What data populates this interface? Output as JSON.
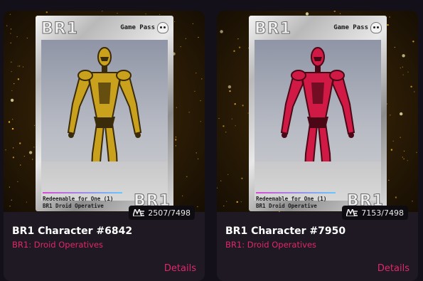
{
  "cards": [
    {
      "card_logo": "BR1",
      "pass_label": "Game Pass",
      "redeem_line1": "Redeemable for One (1)",
      "redeem_line2": "BR1 Droid Operative",
      "bottom_logo": "BR1",
      "count": "2507/7498",
      "title": "BR1 Character #6842",
      "collection": "BR1: Droid Operatives",
      "details_label": "Details",
      "robot_color": "#c9a11c",
      "robot_dark": "#3a2b0a"
    },
    {
      "card_logo": "BR1",
      "pass_label": "Game Pass",
      "redeem_line1": "Redeemable for One (1)",
      "redeem_line2": "BR1 Droid Operative",
      "bottom_logo": "BR1",
      "count": "7153/7498",
      "title": "BR1 Character #7950",
      "collection": "BR1: Droid Operatives",
      "details_label": "Details",
      "robot_color": "#d01a45",
      "robot_dark": "#4a0816"
    }
  ],
  "colors": {
    "accent": "#e0286a",
    "background": "#14101a",
    "card_bg": "#1e1922"
  },
  "icons": [
    "magic-eden-icon",
    "skull-icon"
  ]
}
